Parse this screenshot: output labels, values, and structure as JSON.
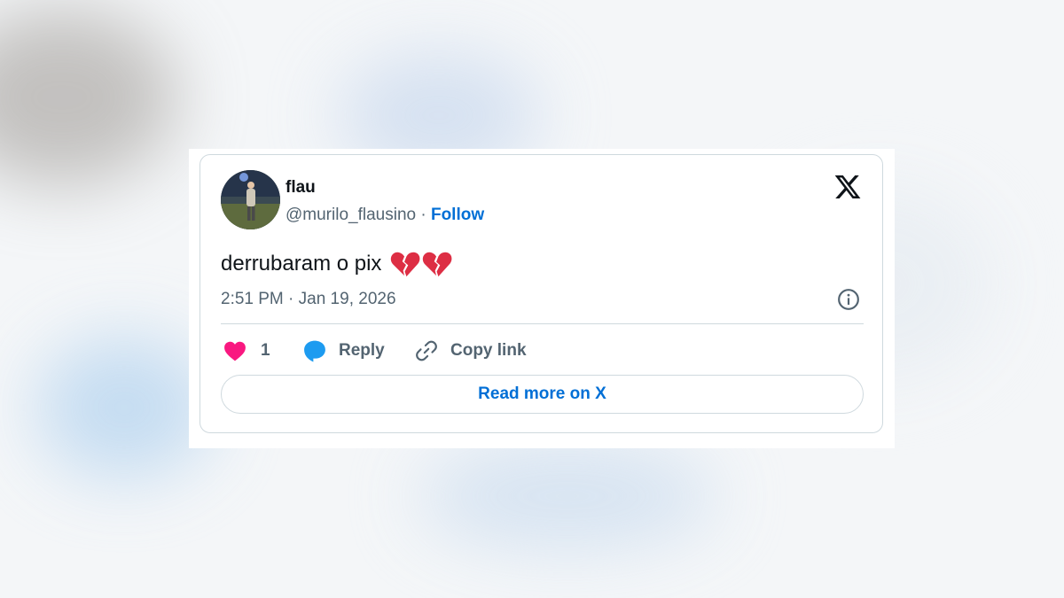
{
  "tweet": {
    "display_name": "flau",
    "handle": "@murilo_flausino",
    "separator": "·",
    "follow_label": "Follow",
    "text": "derrubaram o pix",
    "emojis": [
      "broken-heart-emoji",
      "broken-heart-emoji"
    ],
    "timestamp": "2:51 PM · Jan 19, 2026"
  },
  "actions": {
    "like_count": "1",
    "reply_label": "Reply",
    "copy_label": "Copy link"
  },
  "footer": {
    "read_more_label": "Read more on X"
  },
  "icons": {
    "brand": "x-logo-icon",
    "info": "info-icon",
    "like": "heart-icon",
    "reply": "speech-bubble-icon",
    "copy": "link-icon"
  },
  "colors": {
    "text": "#0f1419",
    "secondary": "#536471",
    "link": "#006fd6",
    "like": "#f91880",
    "reply": "#1d9bf0",
    "border": "#cfd9de",
    "broken_heart": "#dd2e44"
  }
}
